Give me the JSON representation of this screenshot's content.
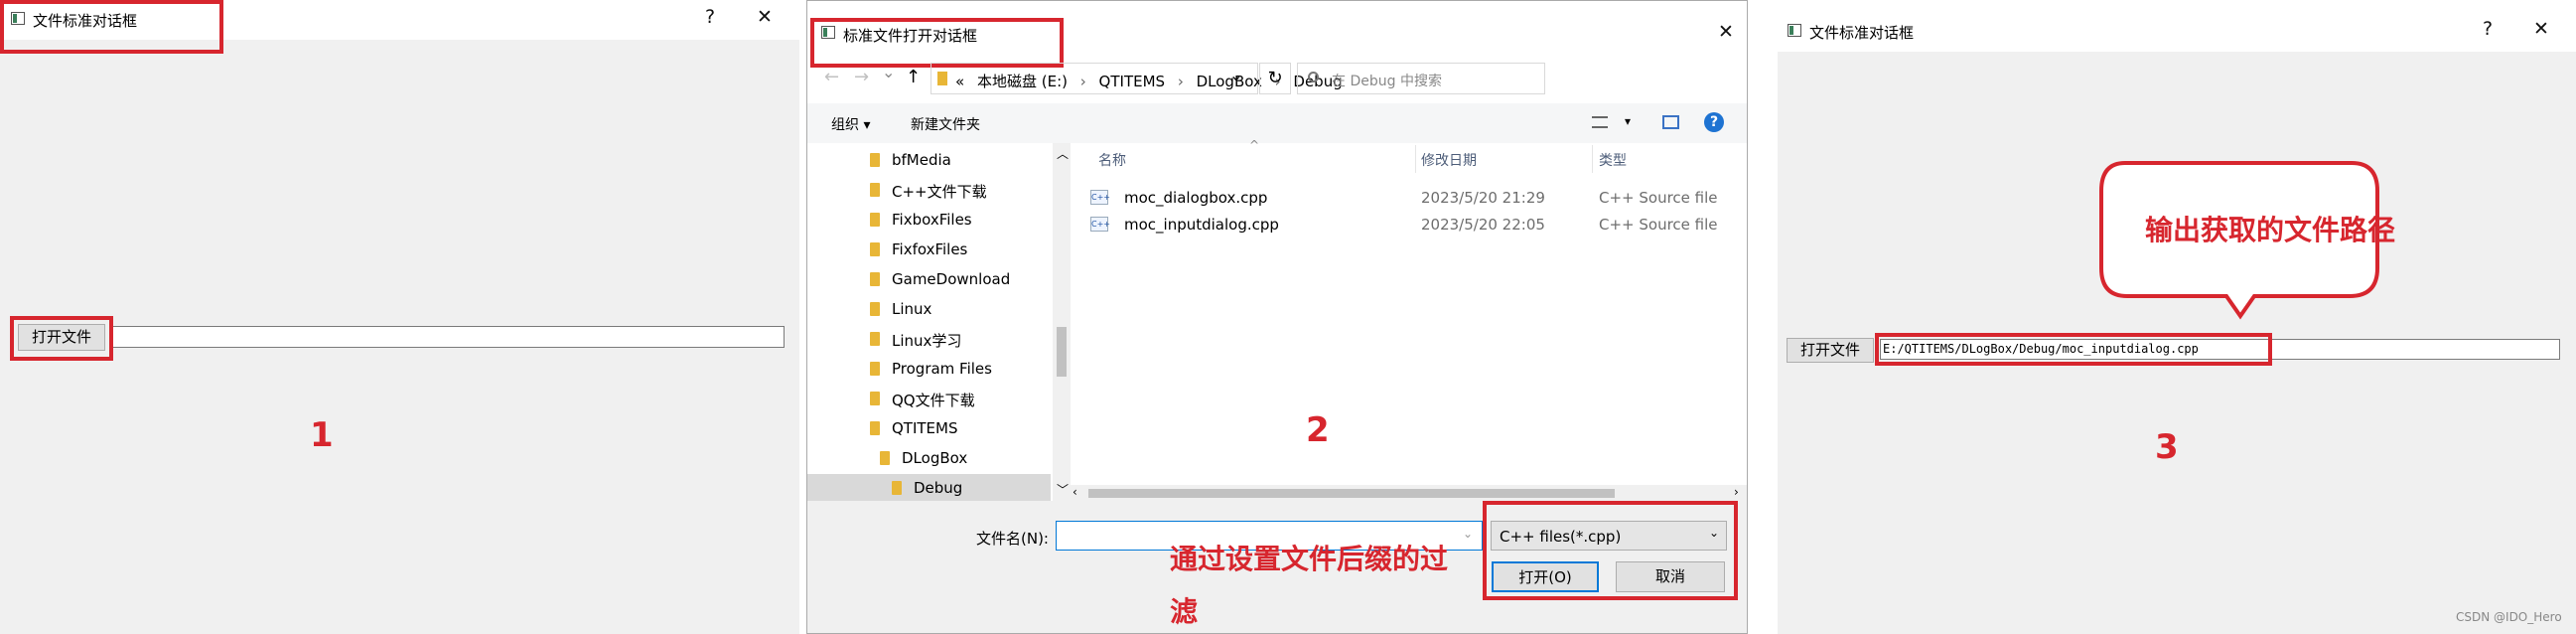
{
  "panel1": {
    "title": "文件标准对话框",
    "help": "?",
    "close": "✕",
    "open_button": "打开文件",
    "path_value": "",
    "step_number": "1"
  },
  "panel2": {
    "title": "标准文件打开对话框",
    "close": "✕",
    "nav": {
      "back": "←",
      "forward": "→",
      "recent": "⌄",
      "up": "↑",
      "refresh": "↻"
    },
    "breadcrumb": [
      "«",
      "本地磁盘 (E:)",
      "QTITEMS",
      "DLogBox",
      "Debug"
    ],
    "breadcrumb_sep": "›",
    "search_placeholder": "在 Debug 中搜索",
    "toolbar": {
      "organize": "组织 ▾",
      "new_folder": "新建文件夹",
      "view_arrow": "▾",
      "help": "?"
    },
    "nav_items": [
      "bfMedia",
      "C++文件下载",
      "FixboxFiles",
      "FixfoxFiles",
      "GameDownload",
      "Linux",
      "Linux学习",
      "Program Files",
      "QQ文件下载",
      "QTITEMS",
      "DLogBox",
      "Debug"
    ],
    "columns": {
      "name": "名称",
      "date": "修改日期",
      "type": "类型",
      "sort": "^"
    },
    "files": [
      {
        "name": "moc_dialogbox.cpp",
        "date": "2023/5/20 21:29",
        "type": "C++ Source file",
        "icon": "C++"
      },
      {
        "name": "moc_inputdialog.cpp",
        "date": "2023/5/20 22:05",
        "type": "C++ Source file",
        "icon": "C++"
      }
    ],
    "filename_label": "文件名(N):",
    "filename_value": "",
    "filter_value": "C++ files(*.cpp)",
    "open_button": "打开(O)",
    "cancel_button": "取消",
    "step_number": "2",
    "annotation_line1": "通过设置文件后缀的过",
    "annotation_line2": "滤"
  },
  "panel3": {
    "title": "文件标准对话框",
    "help": "?",
    "close": "✕",
    "open_button": "打开文件",
    "path_value": "E:/QTITEMS/DLogBox/Debug/moc_inputdialog.cpp",
    "callout": "输出获取的文件路径",
    "step_number": "3"
  },
  "watermark": "CSDN @IDO_Hero",
  "colors": {
    "annotation_red": "#d7262e",
    "window_bg": "#f0f0f0",
    "accent_blue": "#0078d7"
  }
}
